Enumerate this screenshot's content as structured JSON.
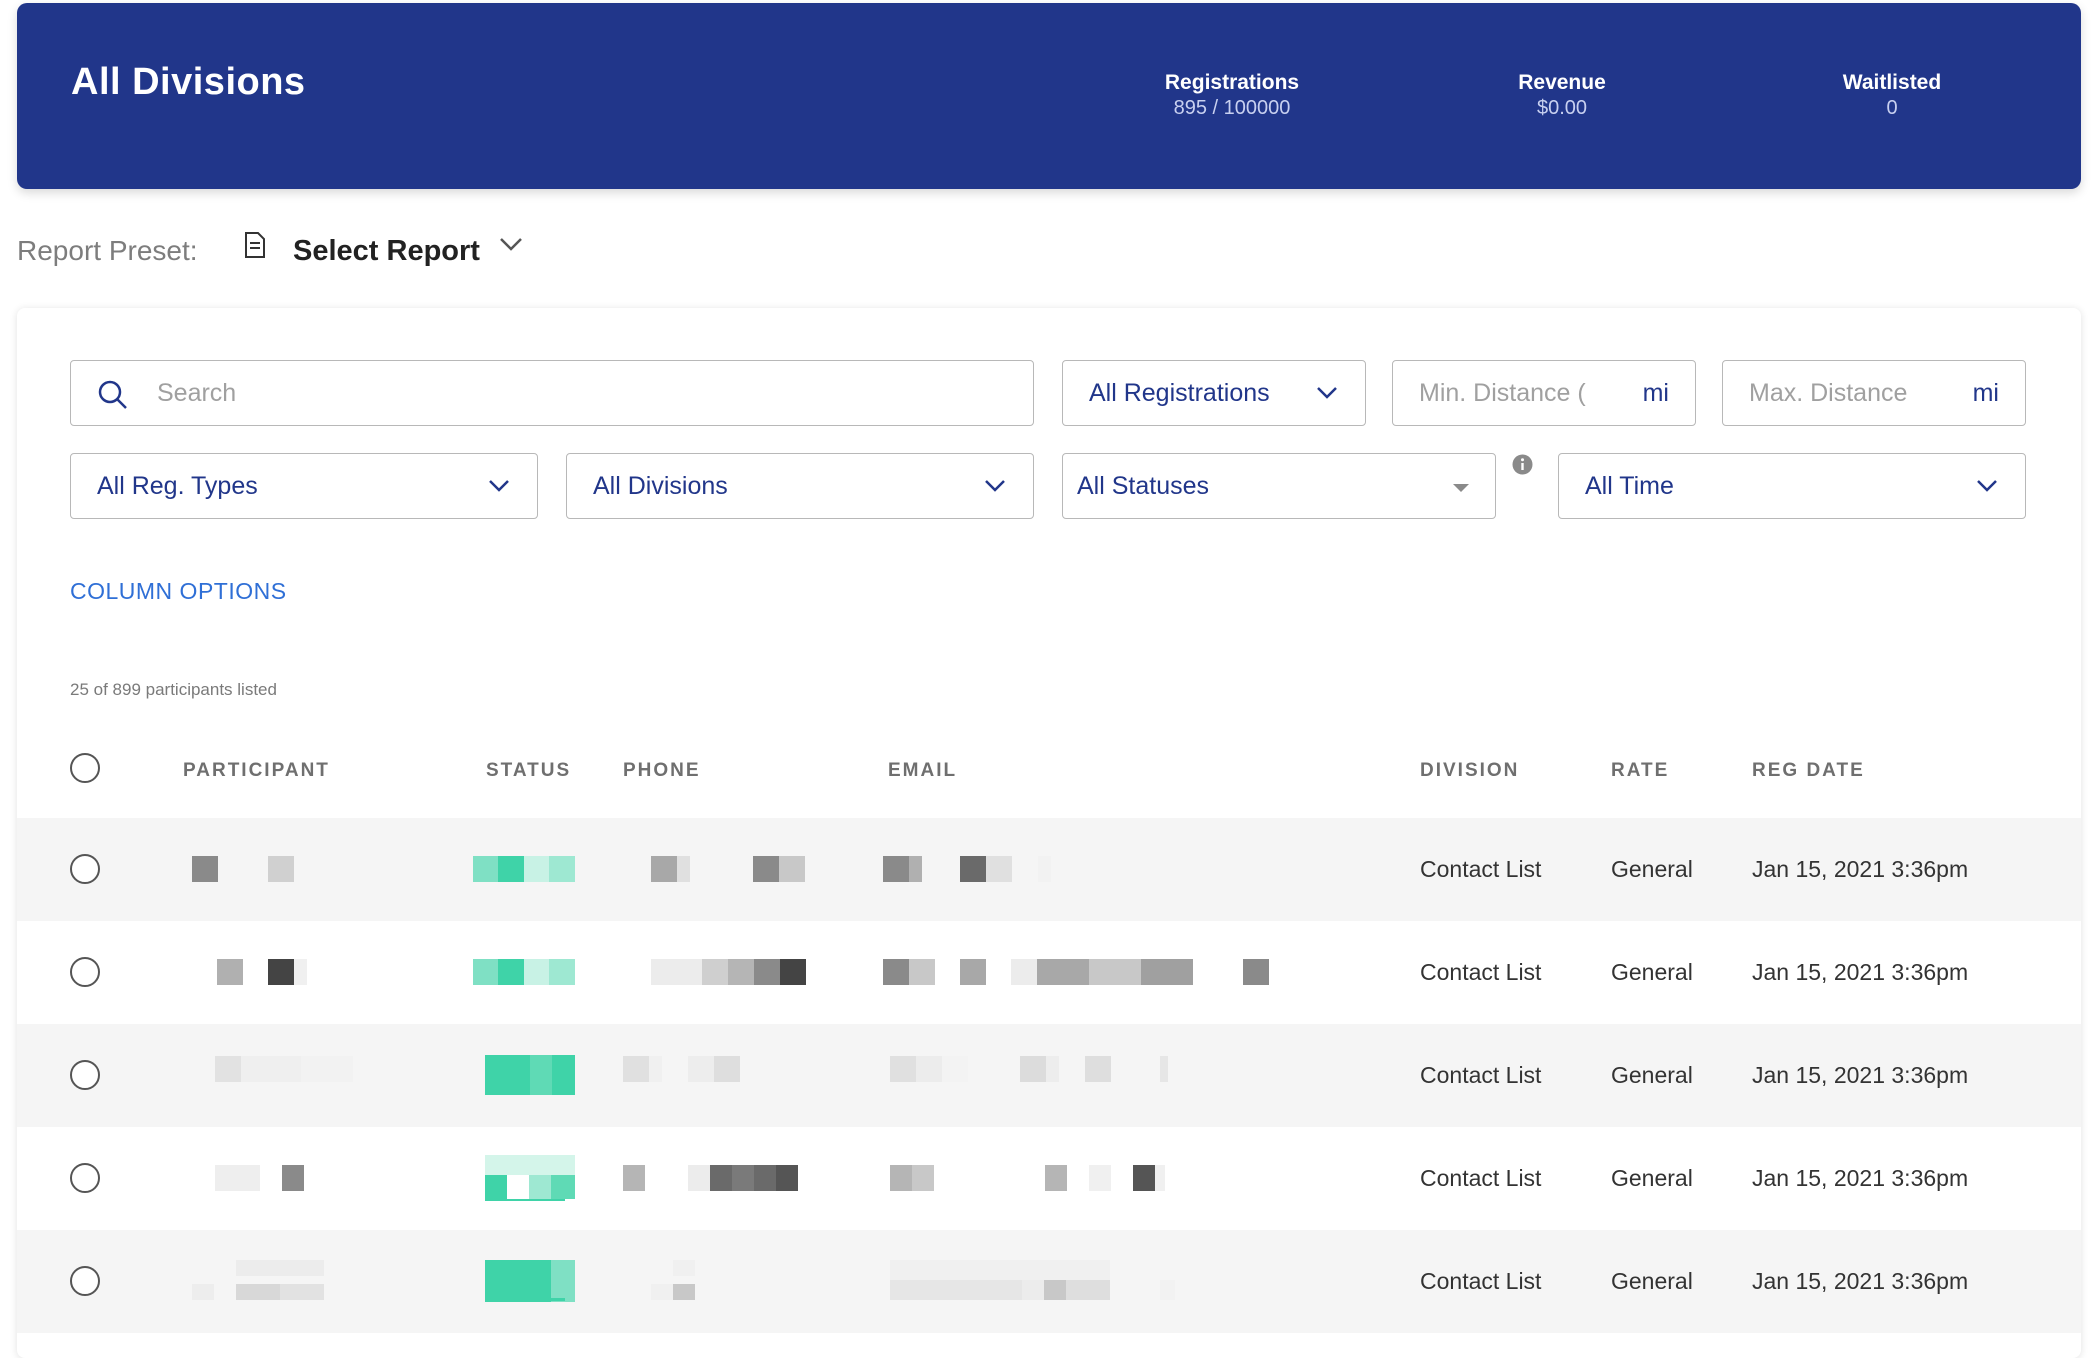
{
  "header": {
    "title": "All Divisions",
    "stats": [
      {
        "label": "Registrations",
        "value": "895 / 100000"
      },
      {
        "label": "Revenue",
        "value": "$0.00"
      },
      {
        "label": "Waitlisted",
        "value": "0"
      }
    ]
  },
  "preset": {
    "label": "Report Preset:",
    "value": "Select Report"
  },
  "filters": {
    "search_placeholder": "Search",
    "registrations": "All Registrations",
    "min_distance_placeholder": "Min. Distance (",
    "max_distance_placeholder": "Max. Distance",
    "distance_unit": "mi",
    "reg_types": "All Reg. Types",
    "divisions": "All Divisions",
    "statuses": "All Statuses",
    "time": "All Time"
  },
  "column_options": "COLUMN OPTIONS",
  "participant_count": "25 of 899 participants listed",
  "table": {
    "columns": [
      "PARTICIPANT",
      "STATUS",
      "PHONE",
      "EMAIL",
      "DIVISION",
      "RATE",
      "REG DATE"
    ],
    "rows": [
      {
        "division": "Contact List",
        "rate": "General",
        "reg_date": "Jan 15, 2021 3:36pm"
      },
      {
        "division": "Contact List",
        "rate": "General",
        "reg_date": "Jan 15, 2021 3:36pm"
      },
      {
        "division": "Contact List",
        "rate": "General",
        "reg_date": "Jan 15, 2021 3:36pm"
      },
      {
        "division": "Contact List",
        "rate": "General",
        "reg_date": "Jan 15, 2021 3:36pm"
      },
      {
        "division": "Contact List",
        "rate": "General",
        "reg_date": "Jan 15, 2021 3:36pm"
      }
    ]
  },
  "colors": {
    "header_bg": "#21368a",
    "accent_text": "#21368a",
    "link": "#2f6fd6",
    "status_green": "#3fd3a8"
  }
}
